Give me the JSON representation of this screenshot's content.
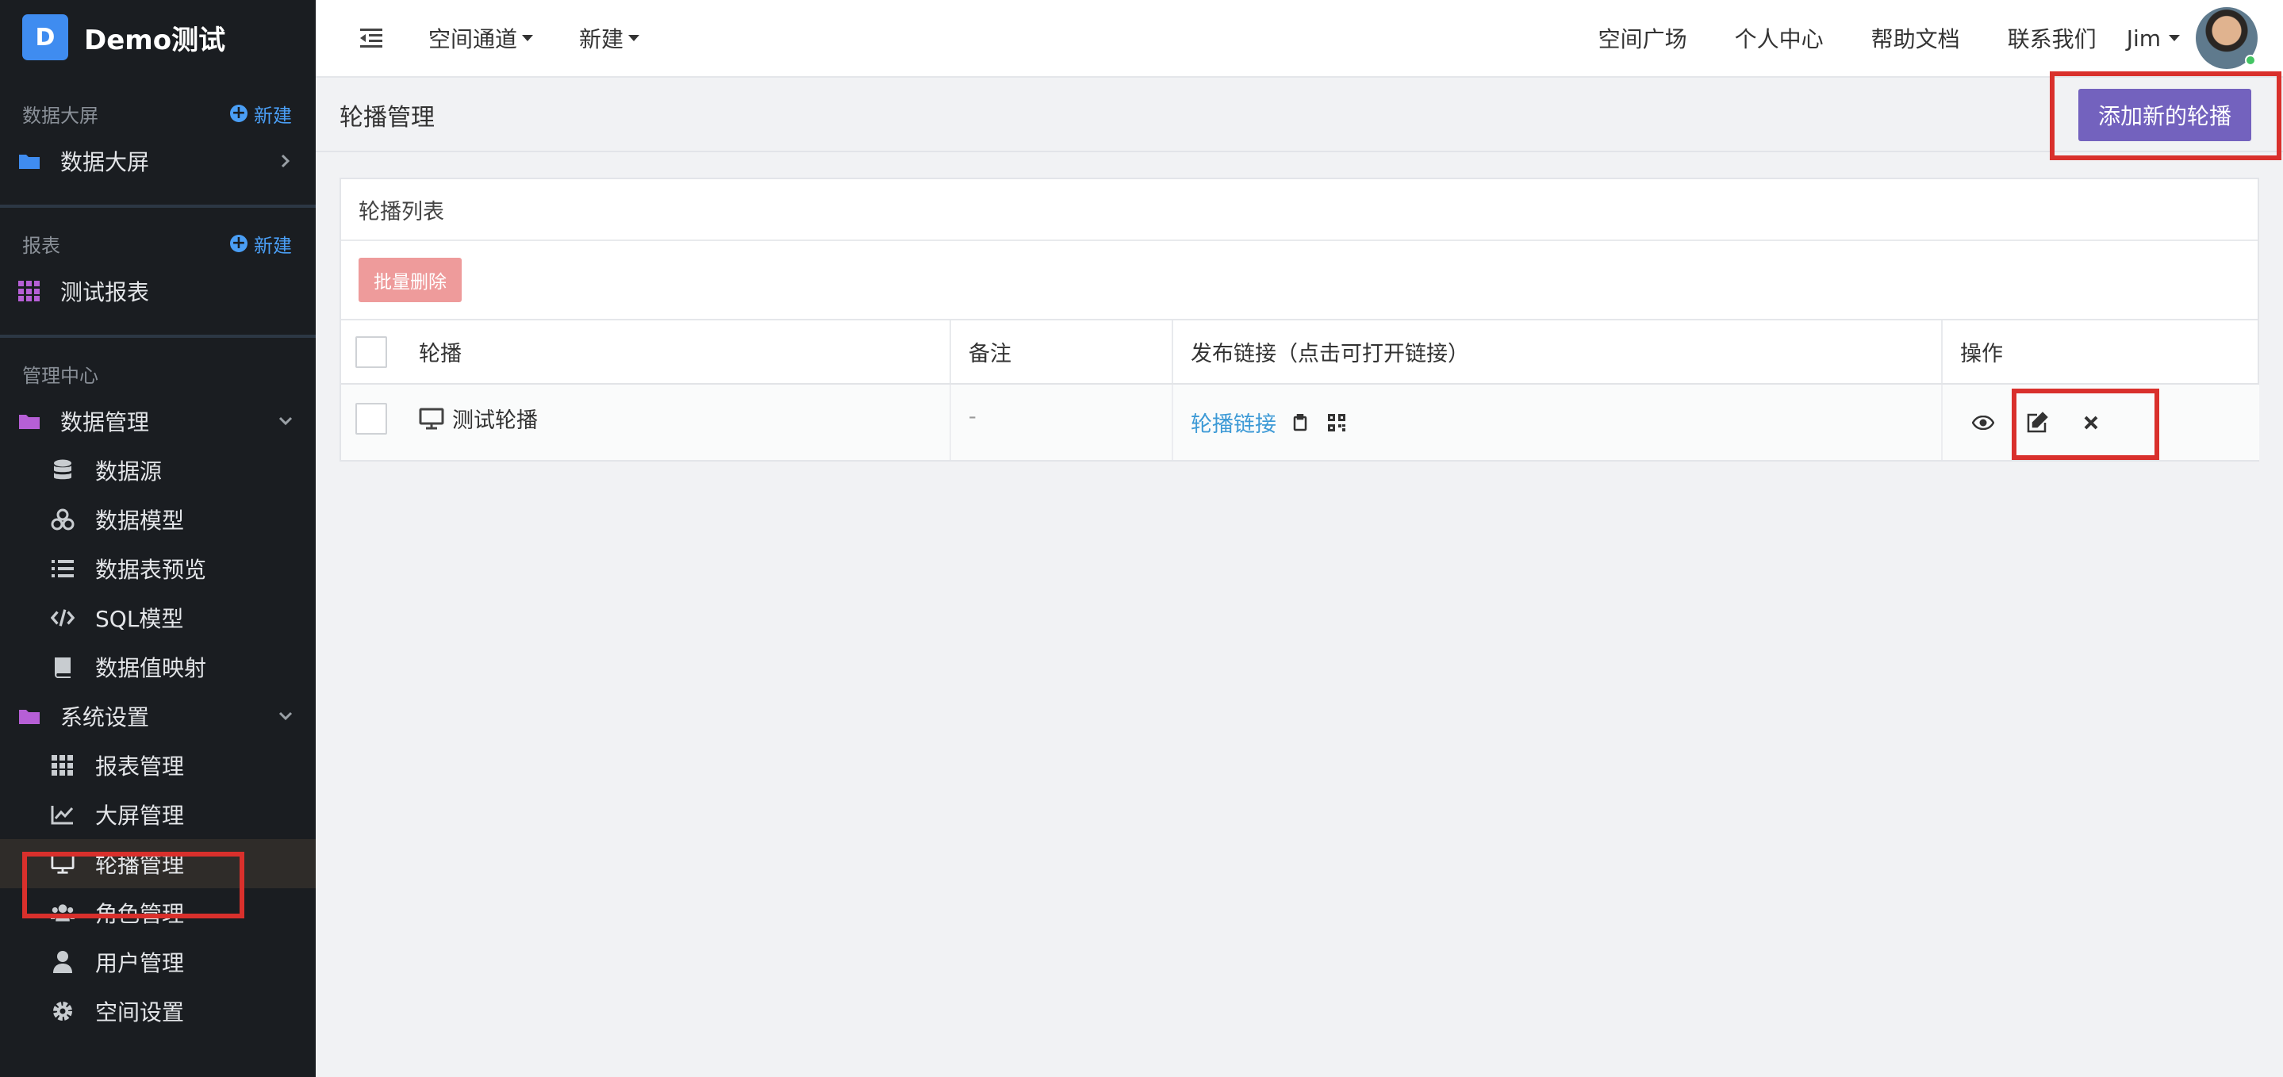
{
  "brand": {
    "logo_letter": "D",
    "name": "Demo测试"
  },
  "sidebar": {
    "sections": [
      {
        "title": "数据大屏",
        "new_label": "新建"
      },
      {
        "title": "报表",
        "new_label": "新建"
      },
      {
        "title": "管理中心"
      }
    ],
    "screen_item": "数据大屏",
    "report_item": "测试报表",
    "data_mgmt": {
      "label": "数据管理",
      "items": [
        "数据源",
        "数据模型",
        "数据表预览",
        "SQL模型",
        "数据值映射"
      ]
    },
    "system": {
      "label": "系统设置",
      "items": [
        "报表管理",
        "大屏管理",
        "轮播管理",
        "角色管理",
        "用户管理",
        "空间设置"
      ]
    },
    "active_item": "轮播管理"
  },
  "topbar": {
    "menus": [
      "空间通道",
      "新建"
    ],
    "links": [
      "空间广场",
      "个人中心",
      "帮助文档",
      "联系我们"
    ],
    "user": "Jim"
  },
  "page": {
    "title": "轮播管理",
    "add_button": "添加新的轮播"
  },
  "card": {
    "title": "轮播列表",
    "bulk_delete": "批量删除",
    "columns": [
      "轮播",
      "备注",
      "发布链接（点击可打开链接）",
      "操作"
    ],
    "rows": [
      {
        "name": "测试轮播",
        "remark": "-",
        "link": "轮播链接"
      }
    ]
  },
  "colors": {
    "accent": "#7362be",
    "danger_light": "#ee9b9b",
    "link": "#3d9ad6",
    "sidebar_bg": "#1a1d21",
    "highlight": "#d9302c"
  }
}
